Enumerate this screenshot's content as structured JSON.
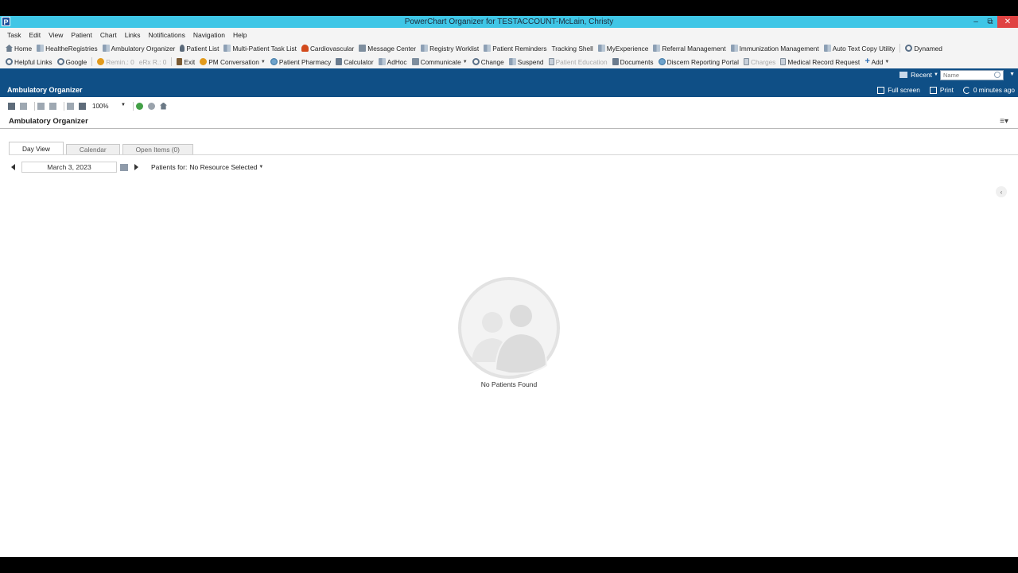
{
  "window": {
    "title": "PowerChart Organizer for TESTACCOUNT-McLain, Christy",
    "app_icon": "P"
  },
  "menubar": [
    "Task",
    "Edit",
    "View",
    "Patient",
    "Chart",
    "Links",
    "Notifications",
    "Navigation",
    "Help"
  ],
  "toolbar1": [
    {
      "label": "Home",
      "icon": "house-icon"
    },
    {
      "label": "HealtheRegistries",
      "icon": "grid-icon"
    },
    {
      "label": "Ambulatory Organizer",
      "icon": "grid-icon"
    },
    {
      "label": "Patient List",
      "icon": "person-icon"
    },
    {
      "label": "Multi-Patient Task List",
      "icon": "grid-icon"
    },
    {
      "label": "Cardiovascular",
      "icon": "heart-icon"
    },
    {
      "label": "Message Center",
      "icon": "mail-icon"
    },
    {
      "label": "Registry Worklist",
      "icon": "grid-icon"
    },
    {
      "label": "Patient Reminders",
      "icon": "grid-icon"
    },
    {
      "label": "Tracking Shell",
      "icon": ""
    },
    {
      "label": "MyExperience",
      "icon": "grid-icon"
    },
    {
      "label": "Referral Management",
      "icon": "grid-icon"
    },
    {
      "label": "Immunization Management",
      "icon": "grid-icon"
    },
    {
      "label": "Auto Text Copy Utility",
      "icon": "grid-icon"
    },
    {
      "label": "Dynamed",
      "icon": "search-icon"
    }
  ],
  "toolbar2": {
    "helpful_links": "Helpful Links",
    "google": "Google",
    "remin": "Remin.: 0",
    "efx": "eRx R.: 0",
    "exit": "Exit",
    "pm_conversation": "PM Conversation",
    "patient_pharmacy": "Patient Pharmacy",
    "calculator": "Calculator",
    "adhoc": "AdHoc",
    "communicate": "Communicate",
    "change": "Change",
    "suspend": "Suspend",
    "patient_education": "Patient Education",
    "documents": "Documents",
    "discern": "Discern Reporting Portal",
    "charges": "Charges",
    "medical_record": "Medical Record Request",
    "add": "Add"
  },
  "search": {
    "recent_label": "Recent",
    "placeholder": "Name"
  },
  "org_header": {
    "title": "Ambulatory Organizer",
    "full_screen": "Full screen",
    "print": "Print",
    "refresh": "0 minutes ago"
  },
  "page": {
    "zoom": "100%",
    "title": "Ambulatory Organizer",
    "tabs": [
      {
        "label": "Day View",
        "active": true
      },
      {
        "label": "Calendar",
        "active": false
      },
      {
        "label": "Open Items  (0)",
        "active": false
      }
    ],
    "date": "March 3, 2023",
    "patients_for_label": "Patients for:",
    "resource_selected": "No Resource Selected",
    "empty_message": "No Patients Found"
  },
  "colors": {
    "titlebar": "#3fc6e6",
    "brand_blue": "#0f4f86",
    "close_red": "#e04343"
  }
}
